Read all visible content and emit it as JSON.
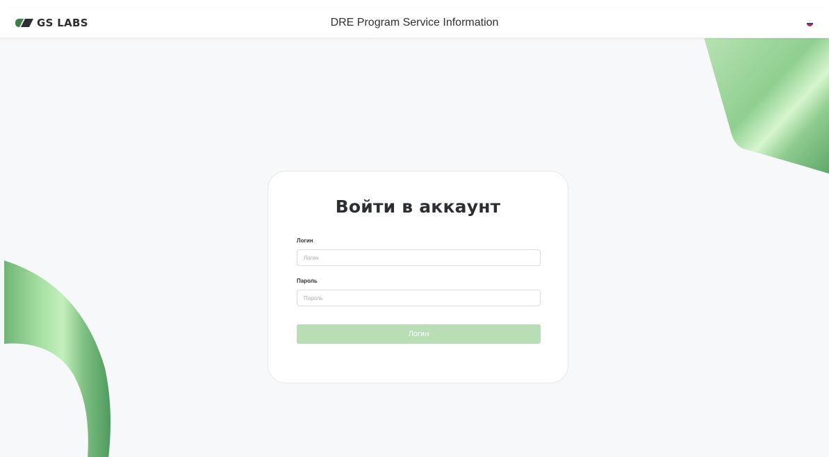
{
  "header": {
    "logo_text": "GS LABS",
    "app_title": "DRE Program Service Information",
    "language_flag": "ru-flag-icon"
  },
  "login_form": {
    "title": "Войти в аккаунт",
    "login_label": "Логин",
    "login_placeholder": "Логин",
    "login_value": "",
    "password_label": "Пароль",
    "password_placeholder": "Пароль",
    "password_value": "",
    "submit_label": "Логин"
  },
  "colors": {
    "background": "#f7f8fa",
    "accent_green": "#b7deb5",
    "logo_green": "#4a8a55",
    "text_dark": "#2b2e33"
  }
}
